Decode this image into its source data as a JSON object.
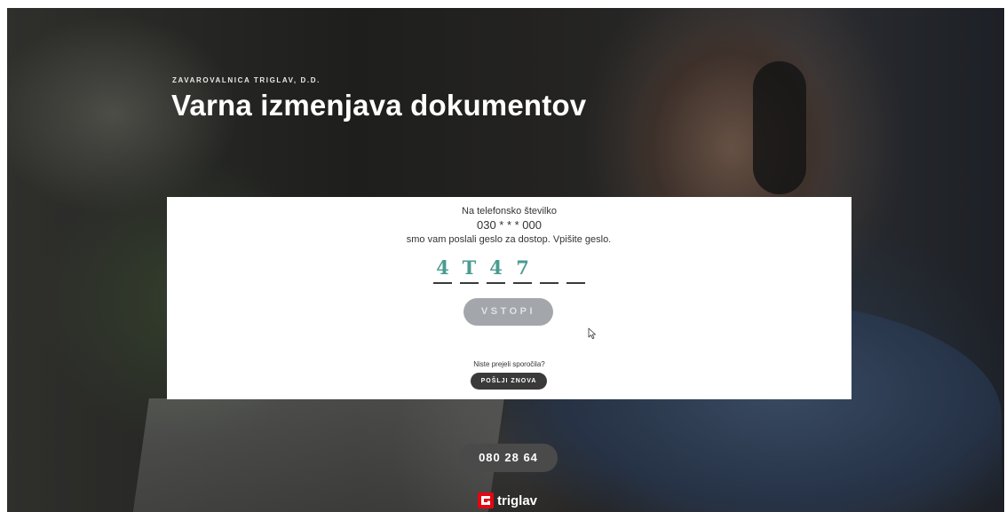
{
  "header": {
    "company": "ZAVAROVALNICA TRIGLAV, D.D.",
    "title": "Varna izmenjava dokumentov"
  },
  "verification": {
    "line1": "Na telefonsko številko",
    "phone": "030 * * * 000",
    "line2": "smo vam poslali geslo za dostop. Vpišite geslo.",
    "code_digits": [
      "4",
      "T",
      "4",
      "7",
      "",
      ""
    ],
    "code_color": "#4a9b90",
    "submit_label": "VSTOPI",
    "not_received": "Niste prejeli sporočila?",
    "resend_label": "POŠLJI ZNOVA"
  },
  "footer": {
    "contact_phone": "080 28 64",
    "brand": "triglav",
    "brand_color": "#e30613"
  },
  "icons": [
    "mouse-cursor-icon",
    "triglav-logo-icon"
  ]
}
